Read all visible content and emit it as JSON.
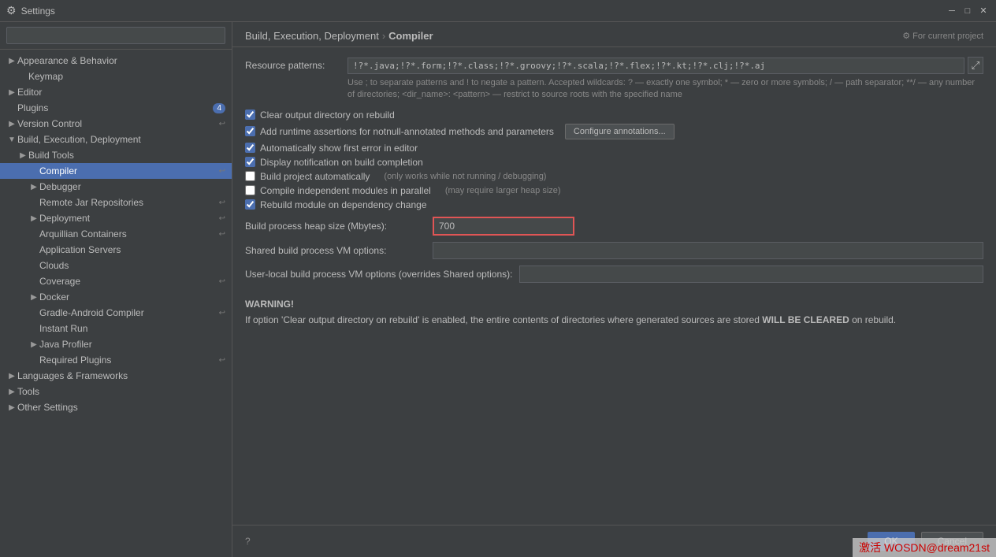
{
  "titleBar": {
    "title": "Settings",
    "closeBtn": "✕",
    "minBtn": "─",
    "maxBtn": "□"
  },
  "sidebar": {
    "searchPlaceholder": "",
    "items": [
      {
        "id": "appearance-behavior",
        "label": "Appearance & Behavior",
        "indent": 0,
        "hasArrow": true,
        "arrowDir": "right",
        "badge": null,
        "iconRight": null
      },
      {
        "id": "keymap",
        "label": "Keymap",
        "indent": 1,
        "hasArrow": false,
        "badge": null,
        "iconRight": null
      },
      {
        "id": "editor",
        "label": "Editor",
        "indent": 0,
        "hasArrow": true,
        "arrowDir": "right",
        "badge": null,
        "iconRight": null
      },
      {
        "id": "plugins",
        "label": "Plugins",
        "indent": 0,
        "hasArrow": false,
        "badge": "4",
        "iconRight": null
      },
      {
        "id": "version-control",
        "label": "Version Control",
        "indent": 0,
        "hasArrow": true,
        "arrowDir": "right",
        "badge": null,
        "iconRight": "⬛"
      },
      {
        "id": "build-execution",
        "label": "Build, Execution, Deployment",
        "indent": 0,
        "hasArrow": true,
        "arrowDir": "down",
        "badge": null,
        "iconRight": null
      },
      {
        "id": "build-tools",
        "label": "Build Tools",
        "indent": 1,
        "hasArrow": true,
        "arrowDir": "right",
        "badge": null,
        "iconRight": null
      },
      {
        "id": "compiler",
        "label": "Compiler",
        "indent": 2,
        "hasArrow": false,
        "badge": null,
        "iconRight": "⬛",
        "selected": true
      },
      {
        "id": "debugger",
        "label": "Debugger",
        "indent": 2,
        "hasArrow": true,
        "arrowDir": "right",
        "badge": null,
        "iconRight": null
      },
      {
        "id": "remote-jar",
        "label": "Remote Jar Repositories",
        "indent": 2,
        "hasArrow": false,
        "badge": null,
        "iconRight": "⬛"
      },
      {
        "id": "deployment",
        "label": "Deployment",
        "indent": 2,
        "hasArrow": true,
        "arrowDir": "right",
        "badge": null,
        "iconRight": "⬛"
      },
      {
        "id": "arquillian",
        "label": "Arquillian Containers",
        "indent": 2,
        "hasArrow": false,
        "badge": null,
        "iconRight": "⬛"
      },
      {
        "id": "app-servers",
        "label": "Application Servers",
        "indent": 2,
        "hasArrow": false,
        "badge": null,
        "iconRight": null
      },
      {
        "id": "clouds",
        "label": "Clouds",
        "indent": 2,
        "hasArrow": false,
        "badge": null,
        "iconRight": null
      },
      {
        "id": "coverage",
        "label": "Coverage",
        "indent": 2,
        "hasArrow": false,
        "badge": null,
        "iconRight": "⬛"
      },
      {
        "id": "docker",
        "label": "Docker",
        "indent": 2,
        "hasArrow": true,
        "arrowDir": "right",
        "badge": null,
        "iconRight": null
      },
      {
        "id": "gradle-android",
        "label": "Gradle-Android Compiler",
        "indent": 2,
        "hasArrow": false,
        "badge": null,
        "iconRight": "⬛"
      },
      {
        "id": "instant-run",
        "label": "Instant Run",
        "indent": 2,
        "hasArrow": false,
        "badge": null,
        "iconRight": null
      },
      {
        "id": "java-profiler",
        "label": "Java Profiler",
        "indent": 2,
        "hasArrow": true,
        "arrowDir": "right",
        "badge": null,
        "iconRight": null
      },
      {
        "id": "required-plugins",
        "label": "Required Plugins",
        "indent": 2,
        "hasArrow": false,
        "badge": null,
        "iconRight": "⬛"
      },
      {
        "id": "languages-frameworks",
        "label": "Languages & Frameworks",
        "indent": 0,
        "hasArrow": true,
        "arrowDir": "right",
        "badge": null,
        "iconRight": null
      },
      {
        "id": "tools",
        "label": "Tools",
        "indent": 0,
        "hasArrow": true,
        "arrowDir": "right",
        "badge": null,
        "iconRight": null
      },
      {
        "id": "other-settings",
        "label": "Other Settings",
        "indent": 0,
        "hasArrow": true,
        "arrowDir": "right",
        "badge": null,
        "iconRight": null
      }
    ]
  },
  "content": {
    "breadcrumb": {
      "parent": "Build, Execution, Deployment",
      "separator": "›",
      "current": "Compiler"
    },
    "forCurrentProject": "⚙ For current project",
    "resourcePatterns": {
      "label": "Resource patterns:",
      "value": "!?*.java;!?*.form;!?*.class;!?*.groovy;!?*.scala;!?*.flex;!?*.kt;!?*.clj;!?*.aj",
      "hint": "Use ; to separate patterns and ! to negate a pattern. Accepted wildcards: ? — exactly one symbol; * — zero or more symbols; / — path separator; **/ — any number of directories; <dir_name>: <pattern> — restrict to source roots with the specified name"
    },
    "checkboxes": [
      {
        "id": "clear-output",
        "checked": true,
        "label": "Clear output directory on rebuild"
      },
      {
        "id": "add-runtime",
        "checked": true,
        "label": "Add runtime assertions for notnull-annotated methods and parameters",
        "hasConfigBtn": true,
        "configBtnLabel": "Configure annotations..."
      },
      {
        "id": "show-first-error",
        "checked": true,
        "label": "Automatically show first error in editor"
      },
      {
        "id": "display-notification",
        "checked": true,
        "label": "Display notification on build completion"
      },
      {
        "id": "build-auto",
        "checked": false,
        "label": "Build project automatically",
        "note": "(only works while not running / debugging)"
      },
      {
        "id": "compile-parallel",
        "checked": false,
        "label": "Compile independent modules in parallel",
        "note": "(may require larger heap size)"
      },
      {
        "id": "rebuild-module",
        "checked": true,
        "label": "Rebuild module on dependency change"
      }
    ],
    "heapSize": {
      "label": "Build process heap size (Mbytes):",
      "value": "700"
    },
    "sharedVMOptions": {
      "label": "Shared build process VM options:",
      "value": ""
    },
    "userLocalVMOptions": {
      "label": "User-local build process VM options (overrides Shared options):",
      "value": ""
    },
    "warning": {
      "title": "WARNING!",
      "text": "If option 'Clear output directory on rebuild' is enabled, the entire contents of directories where generated sources are stored WILL BE CLEARED on rebuild."
    }
  },
  "footer": {
    "okLabel": "OK",
    "cancelLabel": "Cancel"
  }
}
